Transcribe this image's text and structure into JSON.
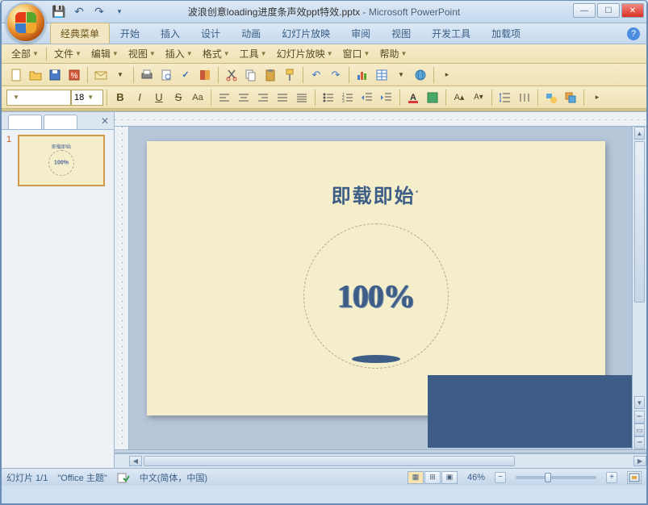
{
  "window": {
    "doc_title": "波浪创意loading进度条声效ppt特效.pptx",
    "app_name": "Microsoft PowerPoint",
    "separator": " - "
  },
  "qat": {
    "save": "💾",
    "undo": "↶",
    "redo": "↷",
    "dropdown": "▾"
  },
  "win_controls": {
    "min": "—",
    "max": "☐",
    "close": "✕"
  },
  "tabs": {
    "classic": "经典菜单",
    "home": "开始",
    "insert": "插入",
    "design": "设计",
    "anim": "动画",
    "slideshow": "幻灯片放映",
    "review": "审阅",
    "view": "视图",
    "developer": "开发工具",
    "addins": "加载项"
  },
  "menu": {
    "all": "全部",
    "file": "文件",
    "edit": "编辑",
    "view": "视图",
    "insert": "插入",
    "format": "格式",
    "tools": "工具",
    "slideshow": "幻灯片放映",
    "window": "窗口",
    "help": "帮助"
  },
  "format": {
    "fontname": "",
    "fontsize": "18",
    "bold": "B",
    "italic": "I",
    "underline": "U",
    "strike": "S",
    "caseswap": "Aa"
  },
  "slide": {
    "title": "即载即始",
    "title_punct": "·",
    "percent": "100%",
    "thumb_percent": "100%",
    "thumb_title": "即载即始"
  },
  "status": {
    "slide_counter": "幻灯片 1/1",
    "theme": "\"Office 主题\"",
    "language": "中文(简体，中国)",
    "zoom": "46%"
  },
  "thumbs": {
    "num1": "1"
  }
}
